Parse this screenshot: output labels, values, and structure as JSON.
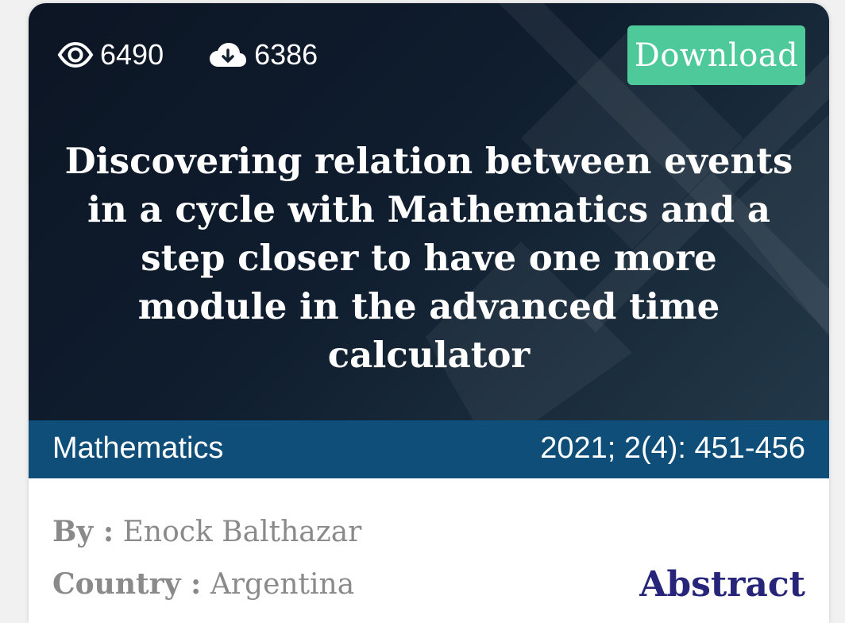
{
  "stats": {
    "views": "6490",
    "downloads": "6386"
  },
  "actions": {
    "download_label": "Download"
  },
  "article": {
    "title": "Discovering relation between events in a cycle with Mathematics and a step closer to have one more module in the advanced time calculator",
    "subject": "Mathematics",
    "citation": "2021; 2(4): 451-456",
    "by_label": "By :",
    "author": "Enock Balthazar",
    "country_label": "Country :",
    "country": "Argentina",
    "abstract_label": "Abstract"
  },
  "icons": {
    "views": "eye-icon",
    "downloads": "cloud-download-icon"
  },
  "colors": {
    "download_button": "#4ec99a",
    "meta_bar": "#0e4e79",
    "abstract_link": "#27257a",
    "muted_text": "#8a8a8a",
    "hero_background": "#0f1d2e"
  }
}
